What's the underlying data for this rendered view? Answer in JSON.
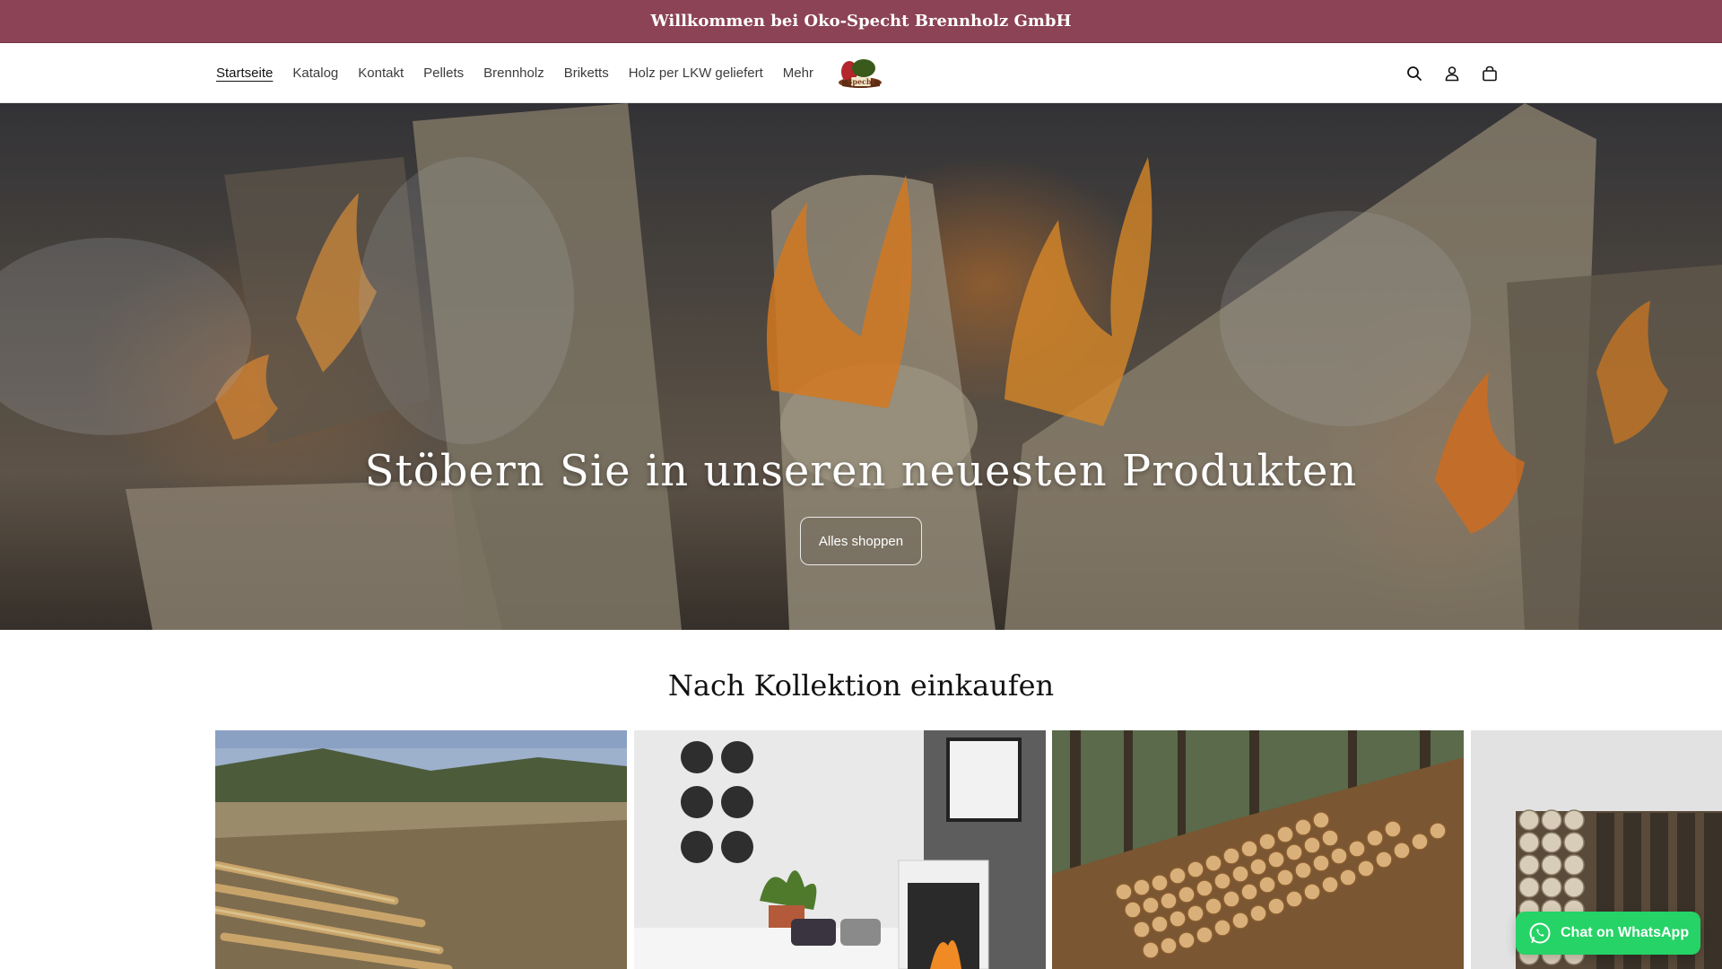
{
  "announcement": {
    "text": "Willkommen bei Oko-Specht Brennholz GmbH"
  },
  "nav": {
    "items": [
      {
        "label": "Startseite",
        "active": true
      },
      {
        "label": "Katalog"
      },
      {
        "label": "Kontakt"
      },
      {
        "label": "Pellets"
      },
      {
        "label": "Brennholz"
      },
      {
        "label": "Briketts"
      },
      {
        "label": "Holz per LKW geliefert"
      },
      {
        "label": "Mehr"
      }
    ]
  },
  "logo": {
    "text": "Specht"
  },
  "header_icons": [
    "search-icon",
    "account-icon",
    "cart-icon"
  ],
  "hero": {
    "title": "Stöbern Sie in unseren neuesten Produkten",
    "button_label": "Alles shoppen"
  },
  "collections": {
    "title": "Nach Kollektion einkaufen"
  },
  "whatsapp": {
    "label": "Chat on WhatsApp",
    "color": "#25d366"
  },
  "colors": {
    "announcement_bg": "#8c4356",
    "text": "#121212"
  }
}
